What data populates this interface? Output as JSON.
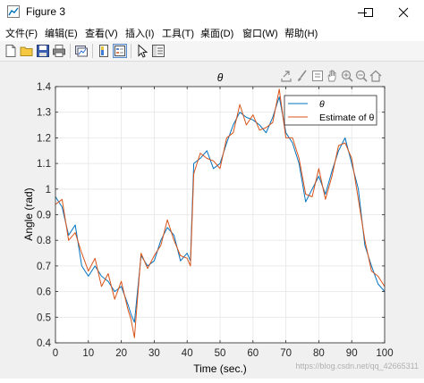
{
  "window": {
    "title": "Figure 3",
    "minimize_glyph": "—",
    "maximize_glyph": "☐",
    "close_glyph": "✕"
  },
  "menu": [
    "文件(F)",
    "编辑(E)",
    "查看(V)",
    "插入(I)",
    "工具(T)",
    "桌面(D)",
    "窗口(W)",
    "帮助(H)"
  ],
  "toolbar_icons": [
    "new-figure-icon",
    "open-file-icon",
    "save-icon",
    "print-icon",
    "link-plot-icon",
    "insert-colorbar-icon",
    "insert-legend-icon",
    "edit-plot-icon",
    "property-inspector-icon"
  ],
  "axes_toolbar_icons": [
    "export-icon",
    "brush-icon",
    "datatip-icon",
    "pan-icon",
    "zoom-in-icon",
    "zoom-out-icon",
    "home-icon"
  ],
  "colors": {
    "theta": "#0072bd",
    "estimate": "#d95319"
  },
  "watermark": "https://blog.csdn.net/qq_42665311",
  "chart_data": {
    "type": "line",
    "title": "θ",
    "xlabel": "Time (sec.)",
    "ylabel": "Angle (rad)",
    "xlim": [
      0,
      100
    ],
    "ylim": [
      0.4,
      1.4
    ],
    "xticks": [
      "0",
      "10",
      "20",
      "30",
      "40",
      "50",
      "60",
      "70",
      "80",
      "90",
      "100"
    ],
    "yticks": [
      "0.4",
      "0.5",
      "0.6",
      "0.7",
      "0.8",
      "0.9",
      "1",
      "1.1",
      "1.2",
      "1.3",
      "1.4"
    ],
    "grid": true,
    "legend_location": "top-right",
    "x": [
      0,
      2,
      4,
      6,
      8,
      10,
      12,
      14,
      16,
      18,
      20,
      22,
      23,
      24,
      26,
      28,
      30,
      32,
      34,
      36,
      38,
      40,
      41,
      42,
      44,
      46,
      48,
      50,
      52,
      54,
      56,
      58,
      60,
      62,
      64,
      66,
      68,
      70,
      72,
      74,
      76,
      78,
      80,
      82,
      84,
      86,
      88,
      90,
      92,
      94,
      96,
      98,
      100
    ],
    "series": [
      {
        "name": "θ",
        "color": "#0072bd",
        "values": [
          0.97,
          0.93,
          0.82,
          0.86,
          0.7,
          0.66,
          0.7,
          0.66,
          0.64,
          0.6,
          0.62,
          0.55,
          0.51,
          0.48,
          0.74,
          0.7,
          0.72,
          0.8,
          0.85,
          0.82,
          0.72,
          0.75,
          0.72,
          1.1,
          1.12,
          1.15,
          1.08,
          1.1,
          1.18,
          1.25,
          1.3,
          1.28,
          1.27,
          1.25,
          1.22,
          1.28,
          1.36,
          1.22,
          1.18,
          1.1,
          0.95,
          1.0,
          1.05,
          0.98,
          1.07,
          1.15,
          1.2,
          1.1,
          1.0,
          0.78,
          0.7,
          0.63,
          0.6
        ]
      },
      {
        "name": "Estimate of θ",
        "color": "#d95319",
        "values": [
          0.94,
          0.96,
          0.8,
          0.83,
          0.75,
          0.68,
          0.73,
          0.62,
          0.67,
          0.57,
          0.64,
          0.53,
          0.49,
          0.42,
          0.75,
          0.69,
          0.74,
          0.78,
          0.88,
          0.8,
          0.74,
          0.73,
          0.7,
          1.06,
          1.14,
          1.12,
          1.11,
          1.08,
          1.2,
          1.22,
          1.33,
          1.25,
          1.29,
          1.23,
          1.24,
          1.26,
          1.39,
          1.2,
          1.2,
          1.12,
          0.98,
          0.97,
          1.08,
          0.96,
          1.05,
          1.17,
          1.18,
          1.12,
          0.96,
          0.8,
          0.68,
          0.66,
          0.62
        ]
      }
    ]
  }
}
